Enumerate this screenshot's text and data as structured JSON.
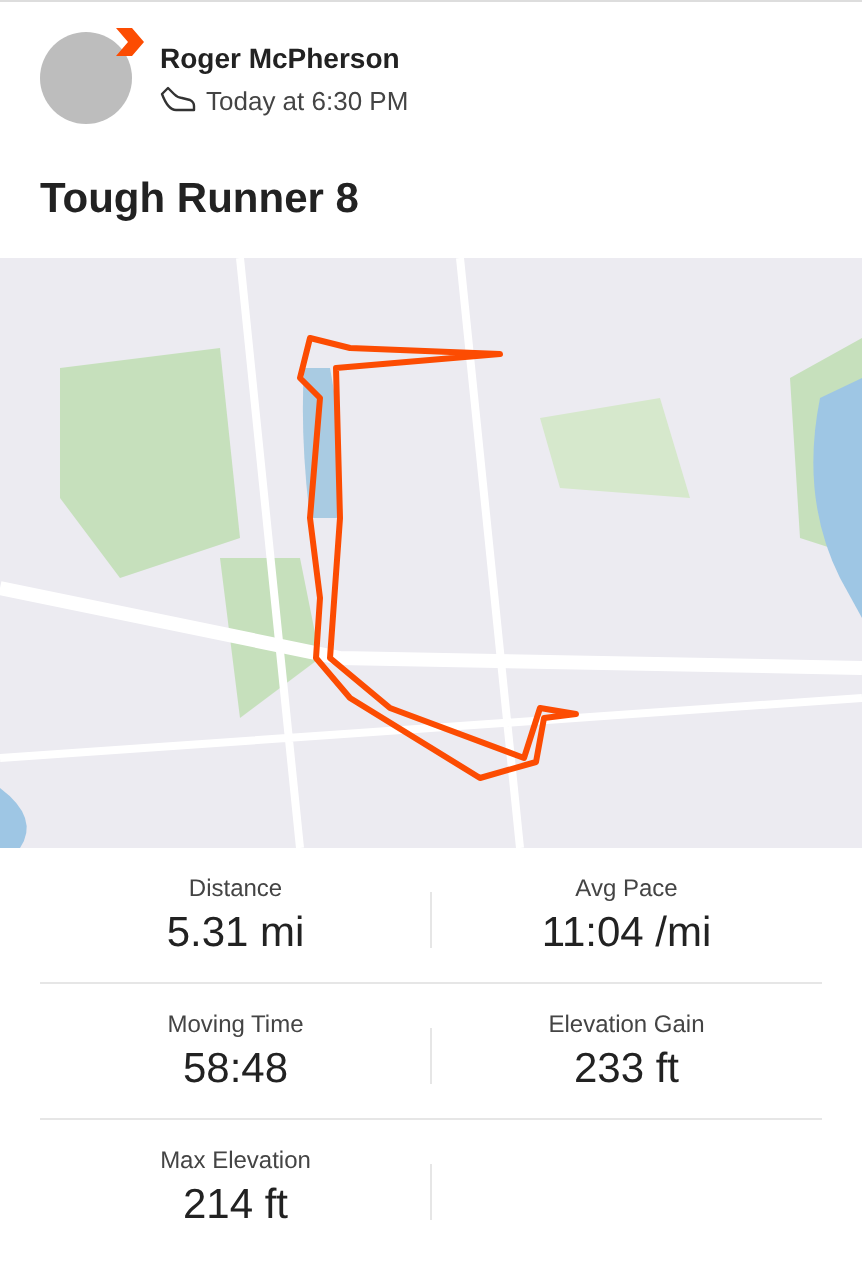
{
  "activity": {
    "athlete": "Roger McPherson",
    "time": "Today at 6:30 PM",
    "title": "Tough Runner 8"
  },
  "stats": [
    {
      "label": "Distance",
      "value": "5.31 mi"
    },
    {
      "label": "Avg Pace",
      "value": "11:04 /mi"
    },
    {
      "label": "Moving Time",
      "value": "58:48"
    },
    {
      "label": "Elevation Gain",
      "value": "233 ft"
    },
    {
      "label": "Max Elevation",
      "value": "214 ft"
    }
  ]
}
